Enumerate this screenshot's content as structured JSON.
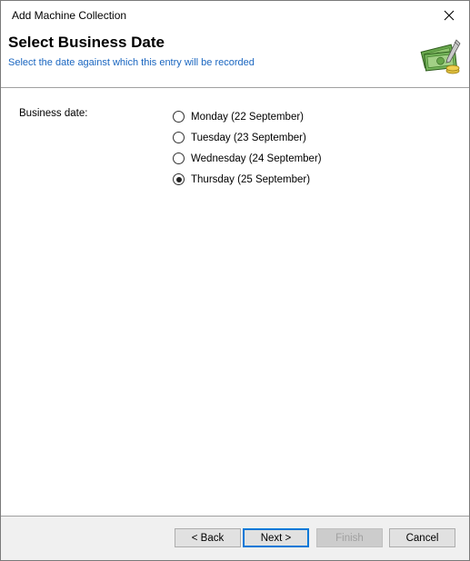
{
  "window": {
    "title": "Add Machine Collection",
    "close_glyph": "✕"
  },
  "header": {
    "title": "Select Business Date",
    "subtitle": "Select the date against which this entry will be recorded",
    "icon": "money-machine-icon"
  },
  "form": {
    "label": "Business date:",
    "options": [
      {
        "label": "Monday (22 September)",
        "checked": false
      },
      {
        "label": "Tuesday (23 September)",
        "checked": false
      },
      {
        "label": "Wednesday (24 September)",
        "checked": false
      },
      {
        "label": "Thursday (25 September)",
        "checked": true
      }
    ]
  },
  "buttons": {
    "back": "< Back",
    "next": "Next >",
    "finish": "Finish",
    "cancel": "Cancel"
  },
  "colors": {
    "subtitle": "#1a66c0",
    "default_button_border": "#0078d7",
    "footer_bg": "#f0f0f0"
  }
}
